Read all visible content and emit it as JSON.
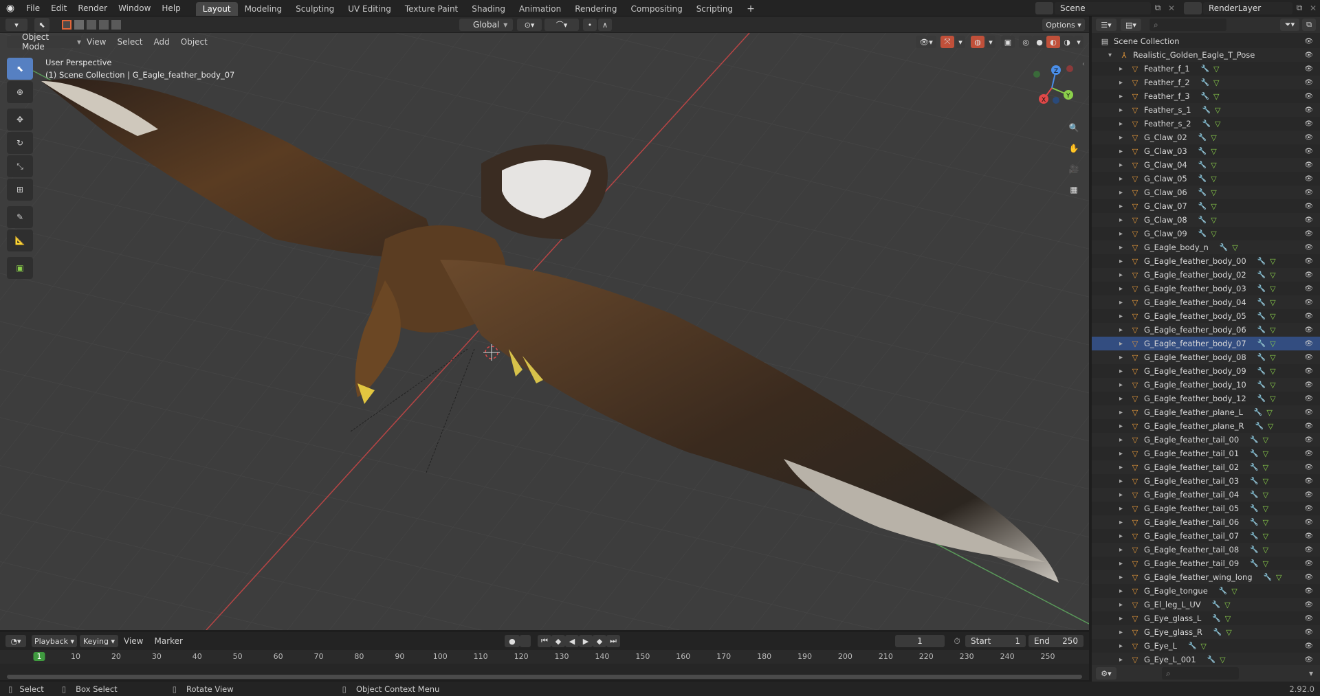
{
  "topbar": {
    "menus": [
      "File",
      "Edit",
      "Render",
      "Window",
      "Help"
    ],
    "workspaces": [
      "Layout",
      "Modeling",
      "Sculpting",
      "UV Editing",
      "Texture Paint",
      "Shading",
      "Animation",
      "Rendering",
      "Compositing",
      "Scripting"
    ],
    "active_workspace": "Layout",
    "add_tab": "+",
    "scene": "Scene",
    "render_layer": "RenderLayer"
  },
  "tool_header": {
    "orientation": "Global",
    "options": "Options"
  },
  "viewport_header": {
    "mode": "Object Mode",
    "menus": [
      "View",
      "Select",
      "Add",
      "Object"
    ]
  },
  "viewport": {
    "perspective": "User Perspective",
    "collection_info": "(1) Scene Collection | G_Eagle_feather_body_07",
    "gizmo_axes": [
      "X",
      "Y",
      "Z"
    ]
  },
  "outliner": {
    "root": "Scene Collection",
    "collection": "Realistic_Golden_Eagle_T_Pose",
    "selected_item": "G_Eagle_feather_body_07",
    "items": [
      "Feather_f_1",
      "Feather_f_2",
      "Feather_f_3",
      "Feather_s_1",
      "Feather_s_2",
      "G_Claw_02",
      "G_Claw_03",
      "G_Claw_04",
      "G_Claw_05",
      "G_Claw_06",
      "G_Claw_07",
      "G_Claw_08",
      "G_Claw_09",
      "G_Eagle_body_n",
      "G_Eagle_feather_body_00",
      "G_Eagle_feather_body_02",
      "G_Eagle_feather_body_03",
      "G_Eagle_feather_body_04",
      "G_Eagle_feather_body_05",
      "G_Eagle_feather_body_06",
      "G_Eagle_feather_body_07",
      "G_Eagle_feather_body_08",
      "G_Eagle_feather_body_09",
      "G_Eagle_feather_body_10",
      "G_Eagle_feather_body_12",
      "G_Eagle_feather_plane_L",
      "G_Eagle_feather_plane_R",
      "G_Eagle_feather_tail_00",
      "G_Eagle_feather_tail_01",
      "G_Eagle_feather_tail_02",
      "G_Eagle_feather_tail_03",
      "G_Eagle_feather_tail_04",
      "G_Eagle_feather_tail_05",
      "G_Eagle_feather_tail_06",
      "G_Eagle_feather_tail_07",
      "G_Eagle_feather_tail_08",
      "G_Eagle_feather_tail_09",
      "G_Eagle_feather_wing_long",
      "G_Eagle_tongue",
      "G_El_leg_L_UV",
      "G_Eye_glass_L",
      "G_Eye_glass_R",
      "G_Eye_L",
      "G_Eye_L_001"
    ]
  },
  "timeline": {
    "menus": [
      "Playback",
      "Keying",
      "View",
      "Marker"
    ],
    "current_frame": "1",
    "start_label": "Start",
    "start": "1",
    "end_label": "End",
    "end": "250",
    "ruler": [
      "1",
      "10",
      "20",
      "30",
      "40",
      "50",
      "60",
      "70",
      "80",
      "90",
      "100",
      "110",
      "120",
      "130",
      "140",
      "150",
      "160",
      "170",
      "180",
      "190",
      "200",
      "210",
      "220",
      "230",
      "240",
      "250"
    ]
  },
  "statusbar": {
    "select": "Select",
    "box_select": "Box Select",
    "rotate_view": "Rotate View",
    "context_menu": "Object Context Menu",
    "version": "2.92.0"
  },
  "colors": {
    "accent": "#5680c2",
    "active_frame": "#3f9a3f",
    "mesh_icon": "#e89a3a",
    "axis_x": "#e04848",
    "axis_y": "#8bd04b",
    "axis_z": "#4a8ee8"
  }
}
